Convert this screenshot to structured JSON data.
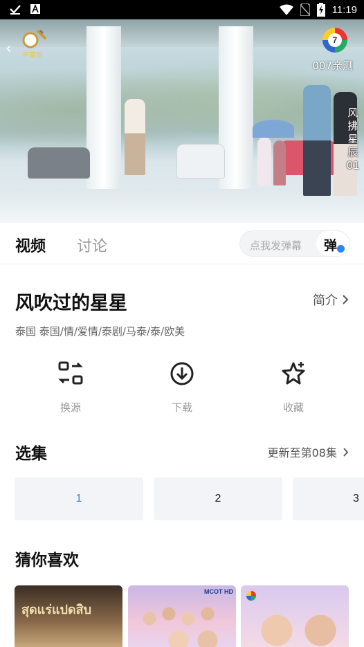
{
  "status_bar": {
    "time": "11:19",
    "icons": [
      "check-icon",
      "notification-a-icon",
      "wifi-icon",
      "no-sim-icon",
      "battery-charging-icon"
    ]
  },
  "player": {
    "watermark": "007亲测",
    "subtitle": "风拂星辰01",
    "channel_number": "7",
    "logo_text": "干草组"
  },
  "tabs": {
    "video": "视频",
    "discussion": "讨论"
  },
  "danmu": {
    "placeholder": "点我发弹幕",
    "button": "弹"
  },
  "show": {
    "title": "风吹过的星星",
    "intro_label": "简介",
    "tags": "泰国  泰国/情/爱情/泰剧/马泰/泰/欧美"
  },
  "actions": [
    {
      "label": "换源",
      "icon": "switch-source-icon"
    },
    {
      "label": "下载",
      "icon": "download-icon"
    },
    {
      "label": "收藏",
      "icon": "favorite-star-icon"
    }
  ],
  "episodes": {
    "header": "选集",
    "update_text": "更新至第08集",
    "items": [
      "1",
      "2",
      "3"
    ],
    "selected": "1"
  },
  "recommend": {
    "header": "猜你喜欢",
    "poster_texts": [
      "สุดแร่แปดสิบ",
      "MCOT HD"
    ]
  },
  "colors": {
    "accent": "#2a85ff",
    "title": "#111111",
    "muted": "#999999",
    "tile": "#f2f4f8"
  }
}
